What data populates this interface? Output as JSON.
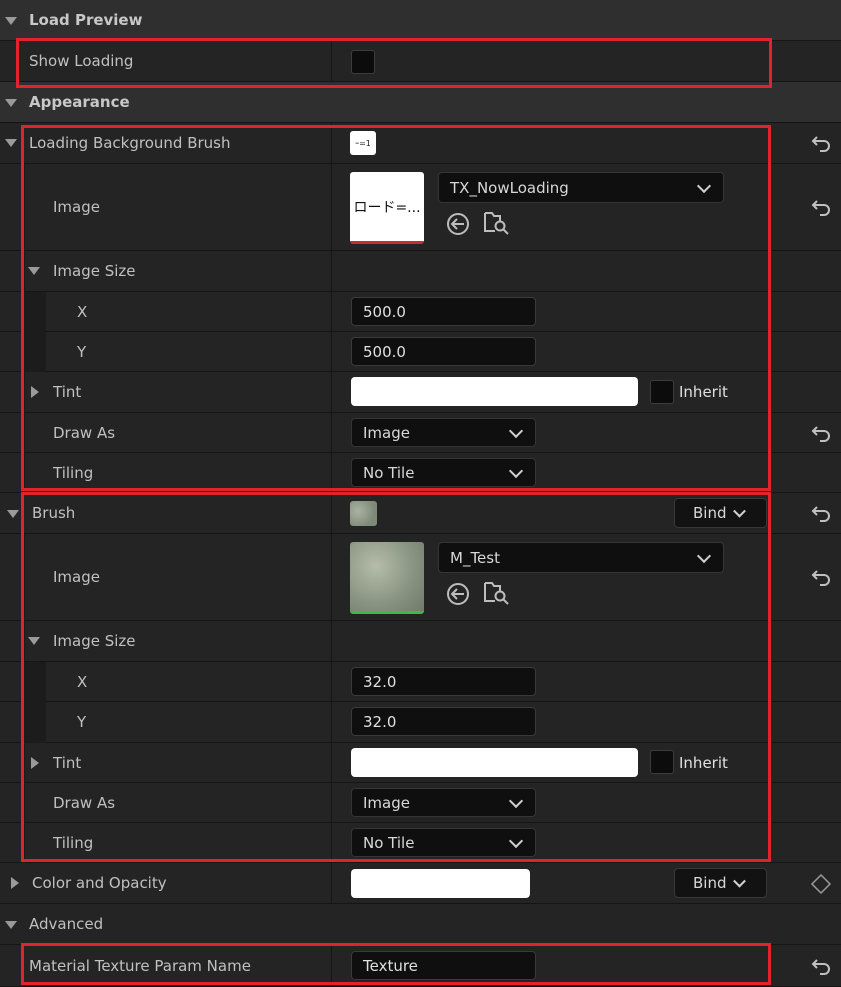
{
  "sections": {
    "load_preview": "Load Preview",
    "appearance": "Appearance",
    "advanced": "Advanced"
  },
  "props": {
    "show_loading": "Show Loading",
    "loading_background_brush": "Loading Background Brush",
    "brush": "Brush",
    "color_and_opacity": "Color and Opacity",
    "material_texture_param_name": "Material Texture Param Name"
  },
  "labels": {
    "image": "Image",
    "image_size": "Image Size",
    "x": "X",
    "y": "Y",
    "tint": "Tint",
    "inherit": "Inherit",
    "draw_as": "Draw As",
    "tiling": "Tiling",
    "bind": "Bind"
  },
  "loading_brush": {
    "image_asset": "TX_NowLoading",
    "thumb_text": "ロード=...",
    "mini_thumb_text": "ｰ=1",
    "size_x": "500.0",
    "size_y": "500.0",
    "draw_as": "Image",
    "tiling": "No Tile"
  },
  "brush": {
    "image_asset": "M_Test",
    "size_x": "32.0",
    "size_y": "32.0",
    "draw_as": "Image",
    "tiling": "No Tile"
  },
  "advanced": {
    "texture_param_value": "Texture"
  },
  "colors": {
    "highlight": "#e0232c",
    "panel": "#242424",
    "category": "#2f2f2f"
  }
}
